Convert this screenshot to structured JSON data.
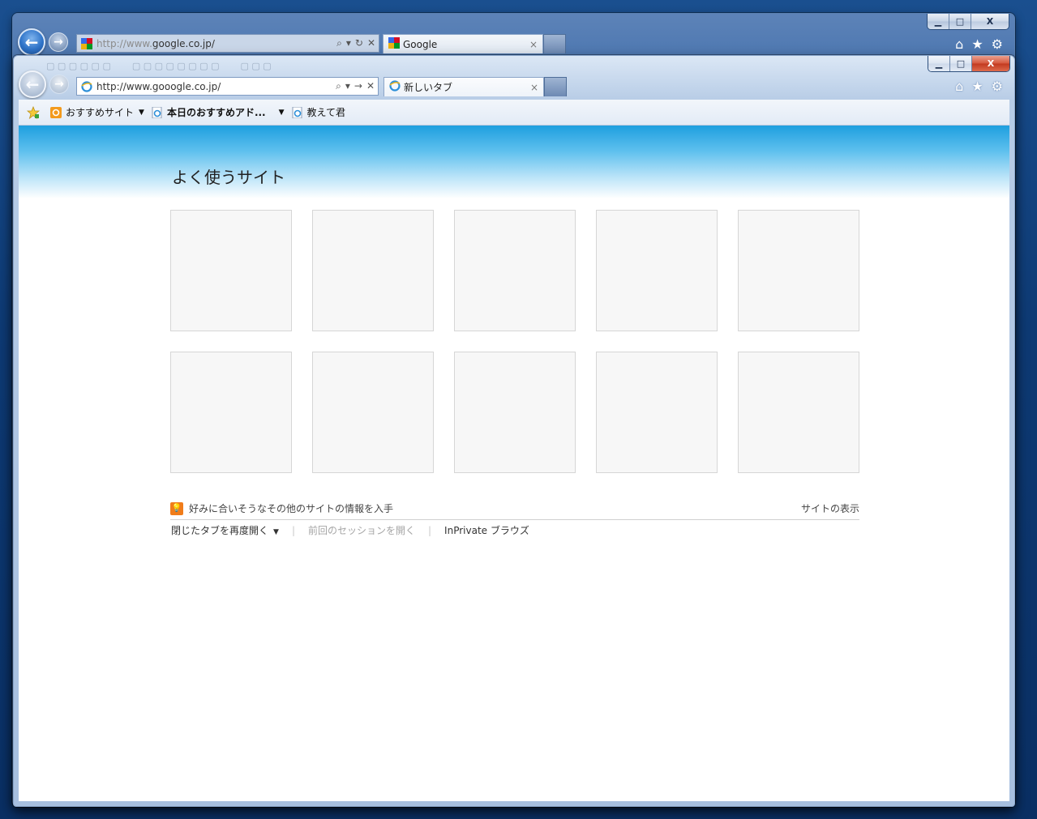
{
  "back_window": {
    "caption": {
      "minimize": "▁",
      "maximize": "□",
      "close": "X"
    },
    "address": {
      "url_prefix": "http://www.",
      "url_main": "google.co.jp/"
    },
    "tab": {
      "title": "Google",
      "close": "×"
    }
  },
  "front_window": {
    "caption": {
      "minimize": "▁",
      "maximize": "□",
      "close": "X"
    },
    "address": {
      "url": "http://www.gooogle.co.jp/"
    },
    "tab": {
      "title": "新しいタブ",
      "close": "×"
    },
    "favorites_bar": {
      "items": [
        {
          "label": "おすすめサイト"
        },
        {
          "label": "本日のおすすめアド..."
        },
        {
          "label": "教えて君"
        }
      ]
    }
  },
  "new_tab_page": {
    "title": "よく使うサイト",
    "tile_count": 10,
    "discover_text": "好みに合いそうなその他のサイトの情報を入手",
    "show_sites": "サイトの表示",
    "reopen_closed_tabs": "閉じたタブを再度開く",
    "reopen_last_session": "前回のセッションを開く",
    "inprivate": "InPrivate ブラウズ"
  },
  "colors": {
    "desktop": "#0e3a74",
    "close_button_red": "#c2391f",
    "sky_blue": "#1e9fdf",
    "tile_bg": "#f7f7f7",
    "tile_border": "#d6d6d6",
    "bulb_orange": "#f07c1a"
  },
  "icons": [
    "back-icon",
    "forward-icon",
    "search-icon",
    "refresh-icon",
    "stop-icon",
    "go-icon",
    "home-icon",
    "favorites-star-icon",
    "gear-icon",
    "add-to-favorites-icon",
    "ie-icon",
    "google-icon",
    "bulb-icon"
  ]
}
